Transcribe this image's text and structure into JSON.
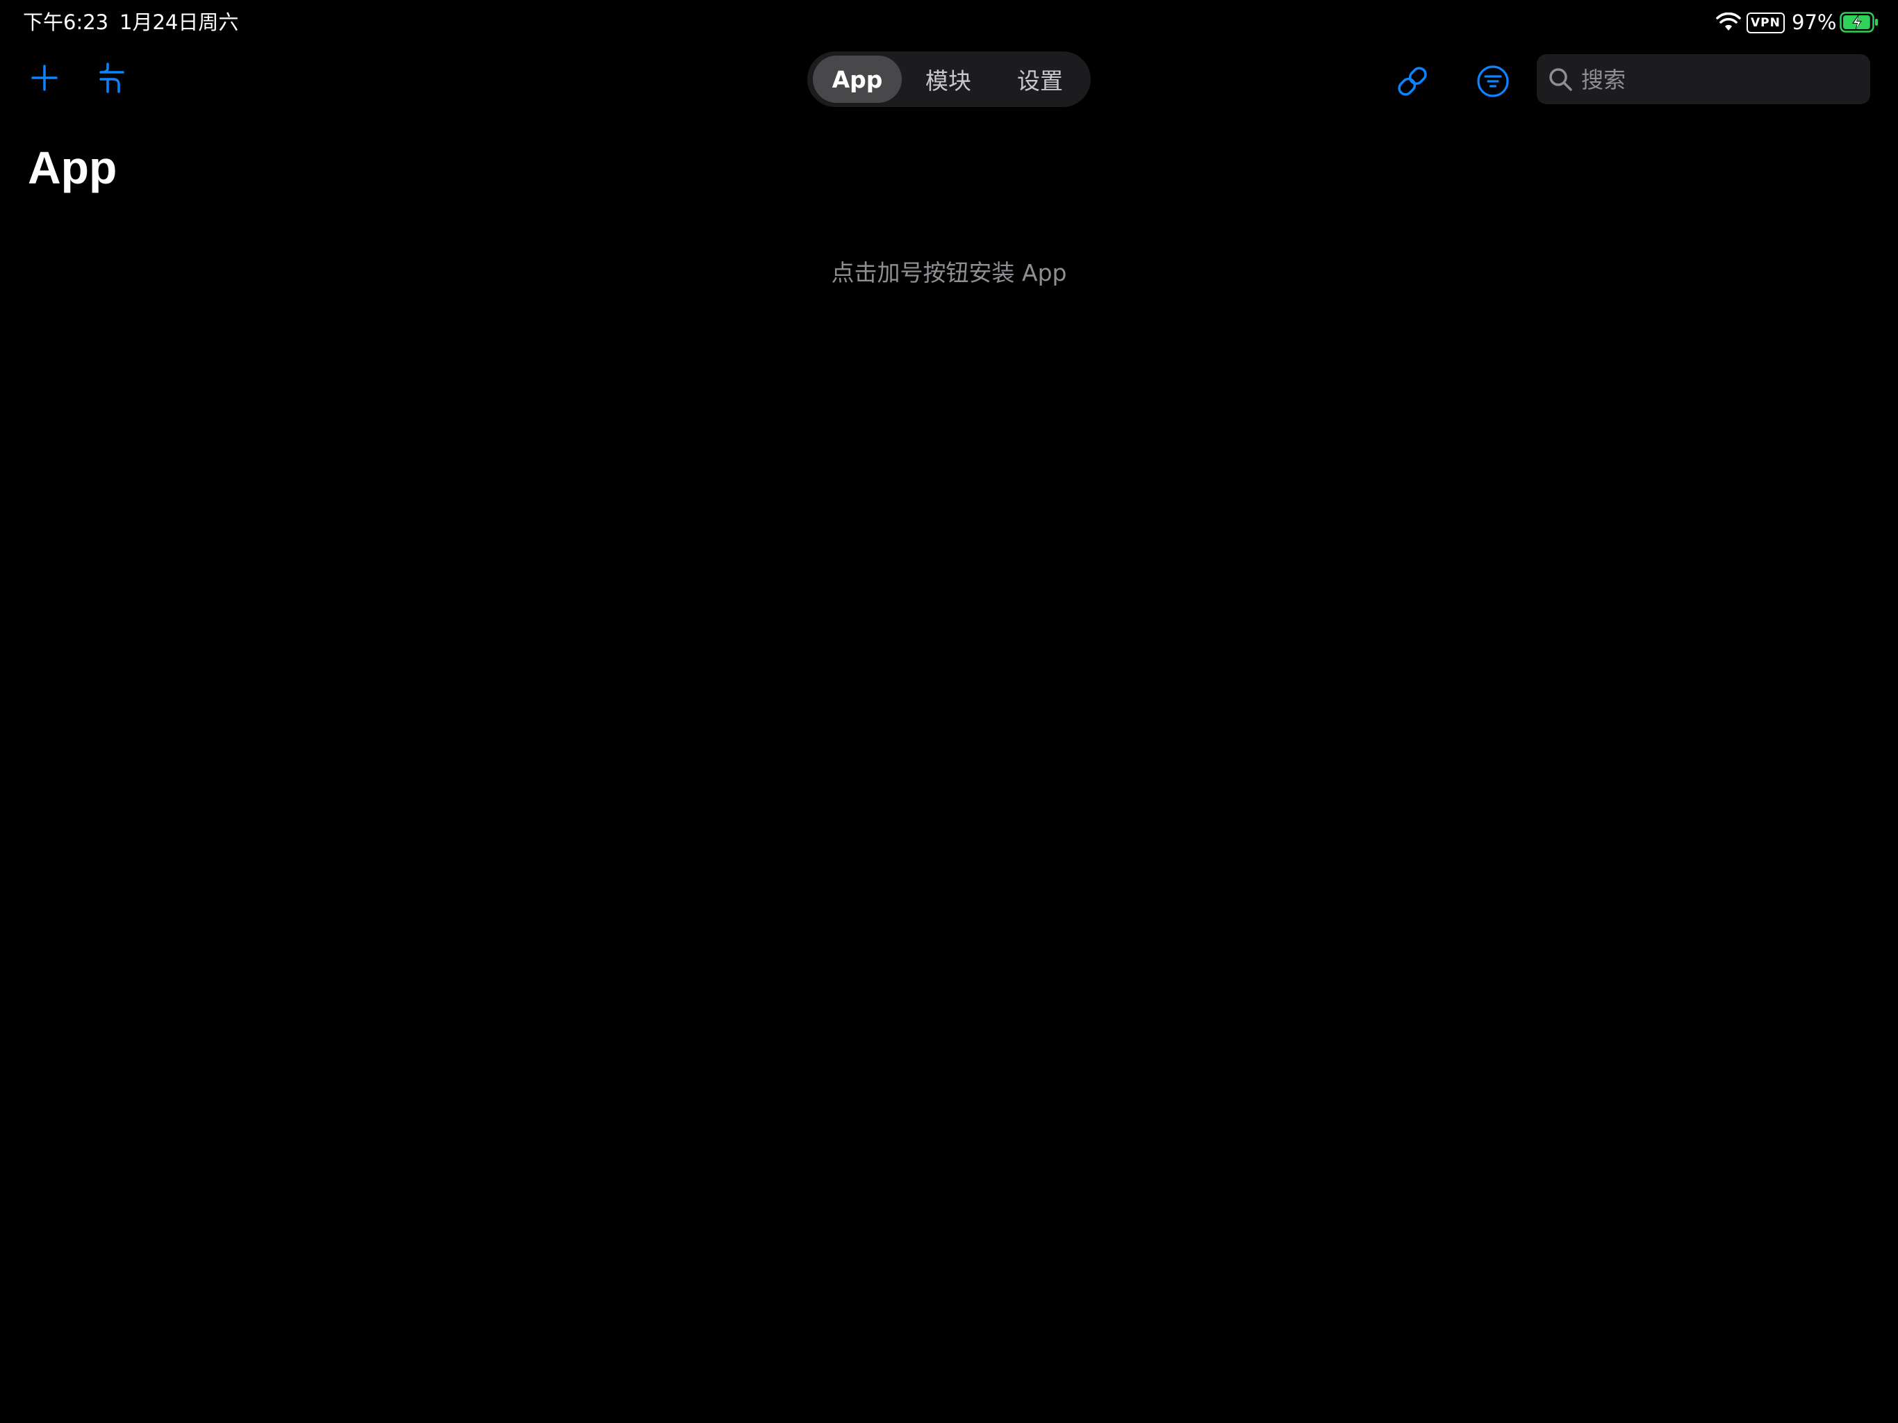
{
  "status_bar": {
    "time": "下午6:23",
    "date": "1月24日周六",
    "vpn_label": "VPN",
    "battery_percent": "97%",
    "battery_level": 0.97,
    "battery_color": "#30d158",
    "icons": [
      "wifi-icon",
      "battery-charging-icon"
    ]
  },
  "toolbar": {
    "accent_color": "#0a84ff",
    "left_icons": [
      "plus-icon",
      "sort-icon"
    ],
    "right_icons": [
      "link-icon",
      "filter-icon"
    ],
    "tabs": [
      {
        "label": "App",
        "selected": true
      },
      {
        "label": "模块",
        "selected": false
      },
      {
        "label": "设置",
        "selected": false
      }
    ],
    "search": {
      "placeholder": "搜索",
      "value": ""
    }
  },
  "main": {
    "title": "App",
    "empty_message": "点击加号按钮安装 App"
  }
}
